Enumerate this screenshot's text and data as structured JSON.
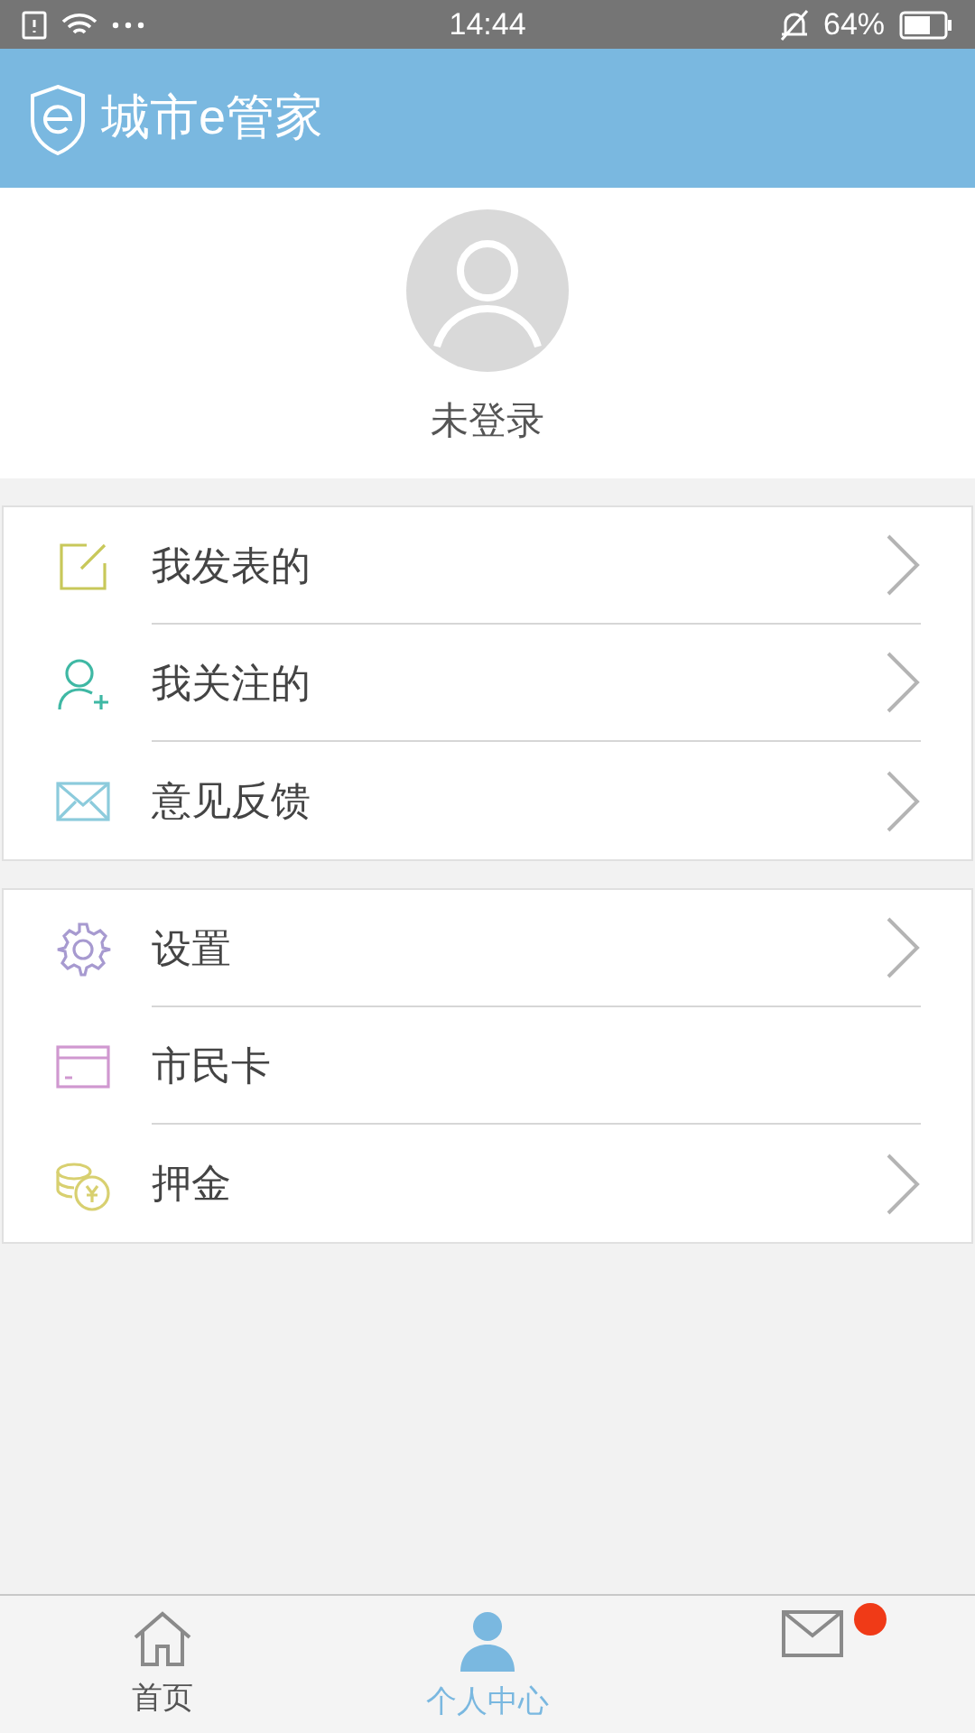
{
  "status_bar": {
    "time": "14:44",
    "battery": "64%"
  },
  "header": {
    "title": "城市e管家"
  },
  "profile": {
    "name": "未登录"
  },
  "menu_groups": [
    [
      {
        "label": "我发表的",
        "has_arrow": true
      },
      {
        "label": "我关注的",
        "has_arrow": true
      },
      {
        "label": "意见反馈",
        "has_arrow": true
      }
    ],
    [
      {
        "label": "设置",
        "has_arrow": true
      },
      {
        "label": "市民卡",
        "has_arrow": false
      },
      {
        "label": "押金",
        "has_arrow": true
      }
    ]
  ],
  "tabs": [
    {
      "label": "首页",
      "selected": false,
      "badge": false
    },
    {
      "label": "个人中心",
      "selected": true,
      "badge": false
    },
    {
      "selected": false,
      "badge": true
    }
  ]
}
